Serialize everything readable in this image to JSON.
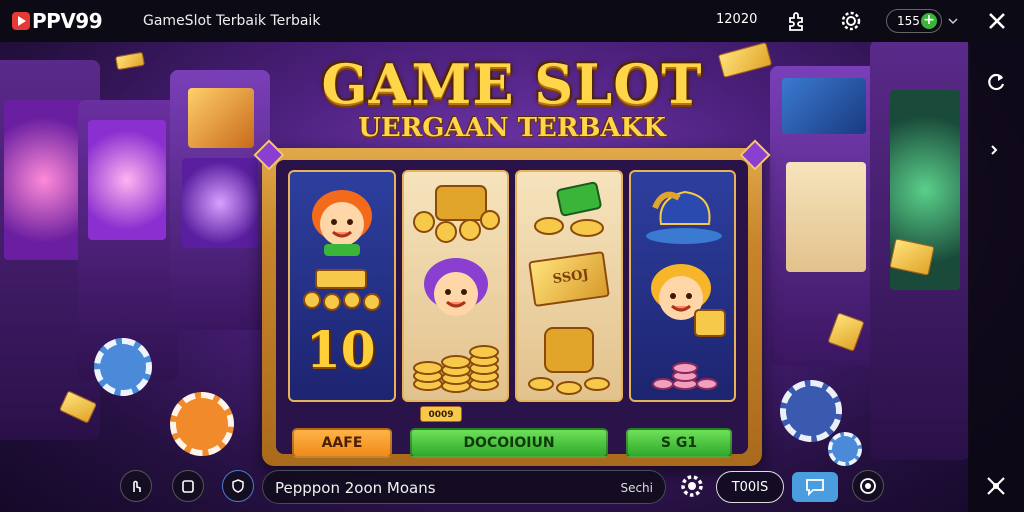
{
  "topbar": {
    "logo_text": "PPV99",
    "tab_title": "GameSlot Terbaik Terbaik",
    "coin_count": "12020",
    "balance": "155"
  },
  "hero": {
    "title": "GAME SLOT",
    "subtitle": "UERGAAN TERBAKK"
  },
  "reels": {
    "big_number": "10",
    "sign_text": "SSOJ"
  },
  "machine": {
    "payline_tag": "0009",
    "buttons": [
      {
        "label": "AAFE",
        "color": "orange"
      },
      {
        "label": "DOCOIOIUN",
        "color": "green"
      },
      {
        "label": "S G1",
        "color": "green"
      }
    ]
  },
  "bottom_bar": {
    "search_value": "Pepppon 2oon Moans",
    "search_action": "Sechi",
    "tools_label": "T00IS"
  },
  "colors": {
    "accent_gold": "#ffd54a",
    "frame_gold": "#c8852a",
    "button_green": "#2fa82a",
    "button_orange": "#f08a1a",
    "chat_blue": "#4a9ee0"
  },
  "icons": [
    "play-logo-icon",
    "puzzle-icon",
    "gear-icon",
    "plus-icon",
    "close-icon",
    "chip-icon",
    "chevron-icon",
    "phone-icon",
    "move-icon",
    "hand-icon",
    "apps-icon",
    "shield-icon",
    "settings-icon",
    "chat-icon",
    "refresh-icon"
  ]
}
